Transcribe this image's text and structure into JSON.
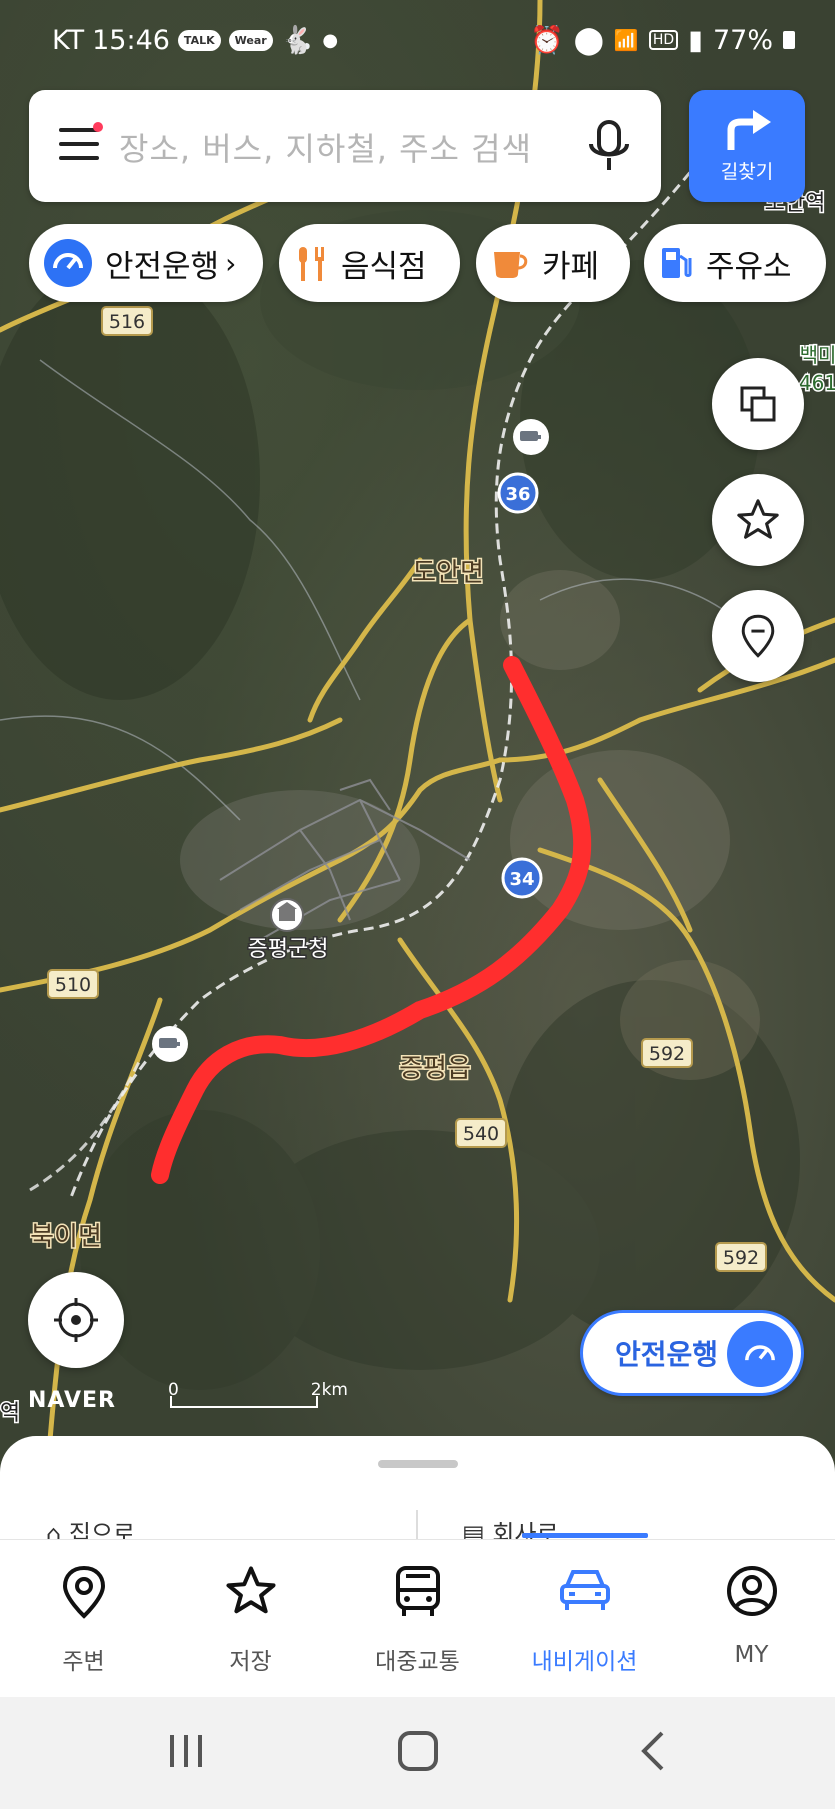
{
  "status_bar": {
    "carrier": "KT",
    "time": "15:46",
    "notif_1": "TALK",
    "notif_2": "Wear",
    "battery": "77%",
    "hd": "HD"
  },
  "search": {
    "placeholder": "장소, 버스, 지하철, 주소 검색"
  },
  "route_button": {
    "label": "길찾기"
  },
  "chips": [
    {
      "label": "안전운행",
      "icon": "speedometer-icon"
    },
    {
      "label": "음식점",
      "icon": "fork-knife-icon"
    },
    {
      "label": "카페",
      "icon": "cup-icon"
    },
    {
      "label": "주유소",
      "icon": "fuel-pump-icon"
    }
  ],
  "map": {
    "place_labels": {
      "doan": "도안면",
      "jeungpyeong_office": "증평군청",
      "jeungpyeong_eup": "증평읍",
      "bugi": "북이면",
      "doanyeok": "도안역",
      "baekma": "백미",
      "baekma_num": "461",
      "left_yeok": "역"
    },
    "road_shields": {
      "r516": "516",
      "r510": "510",
      "r592a": "592",
      "r592b": "592",
      "r540": "540",
      "r36": "36",
      "r34": "34"
    },
    "brand": "NAVER",
    "scale_zero": "0",
    "scale_km": "2km",
    "route_color": "#ff2e2e",
    "satellite": true
  },
  "side_buttons": [
    "layers-icon",
    "star-icon",
    "pin-icon"
  ],
  "safe_drive_button": {
    "label": "안전운행"
  },
  "sheet": {
    "home": "집으로",
    "work": "회사로"
  },
  "tabs": [
    {
      "label": "주변",
      "icon": "location-pin-icon",
      "active": false
    },
    {
      "label": "저장",
      "icon": "star-icon",
      "active": false
    },
    {
      "label": "대중교통",
      "icon": "bus-icon",
      "active": false
    },
    {
      "label": "내비게이션",
      "icon": "car-icon",
      "active": true
    },
    {
      "label": "MY",
      "icon": "user-circle-icon",
      "active": false
    }
  ],
  "colors": {
    "accent": "#3a7bff",
    "route": "#ff2e2e"
  }
}
